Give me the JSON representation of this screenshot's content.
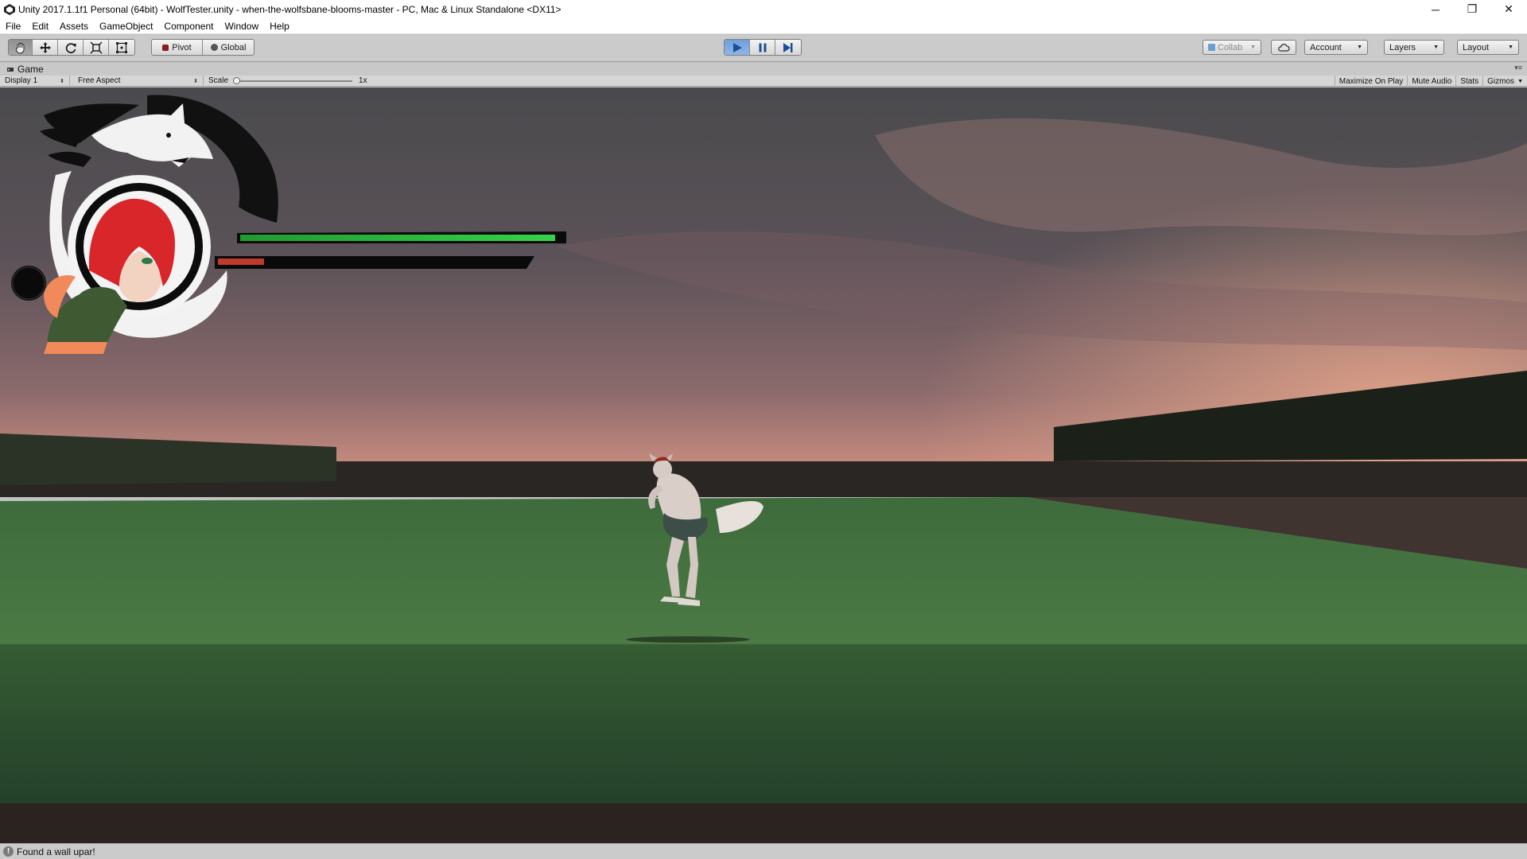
{
  "window": {
    "title": "Unity 2017.1.1f1 Personal (64bit) - WolfTester.unity - when-the-wolfsbane-blooms-master - PC, Mac & Linux Standalone <DX11>",
    "minimize": "─",
    "restore": "❐",
    "close": "✕"
  },
  "menu": {
    "items": [
      "File",
      "Edit",
      "Assets",
      "GameObject",
      "Component",
      "Window",
      "Help"
    ]
  },
  "toolbar": {
    "pivot_label": "Pivot",
    "global_label": "Global",
    "collab_label": "Collab",
    "account_label": "Account",
    "layers_label": "Layers",
    "layout_label": "Layout"
  },
  "game": {
    "tab_label": "Game",
    "display_label": "Display 1",
    "aspect_label": "Free Aspect",
    "scale_label": "Scale",
    "scale_value": "1x",
    "maximize_label": "Maximize On Play",
    "mute_label": "Mute Audio",
    "stats_label": "Stats",
    "gizmos_label": "Gizmos"
  },
  "hud": {
    "health_fraction": 0.97,
    "stamina_fraction": 0.15,
    "health_color": "#2ecc40",
    "stamina_color": "#c0392b"
  },
  "status": {
    "message": "Found a wall upar!"
  },
  "colors": {
    "play_accent": "#4a8bd6",
    "sky_top": "#4c4c4f",
    "sky_horizon": "#d69a86",
    "grass": "#3f6a3c"
  }
}
